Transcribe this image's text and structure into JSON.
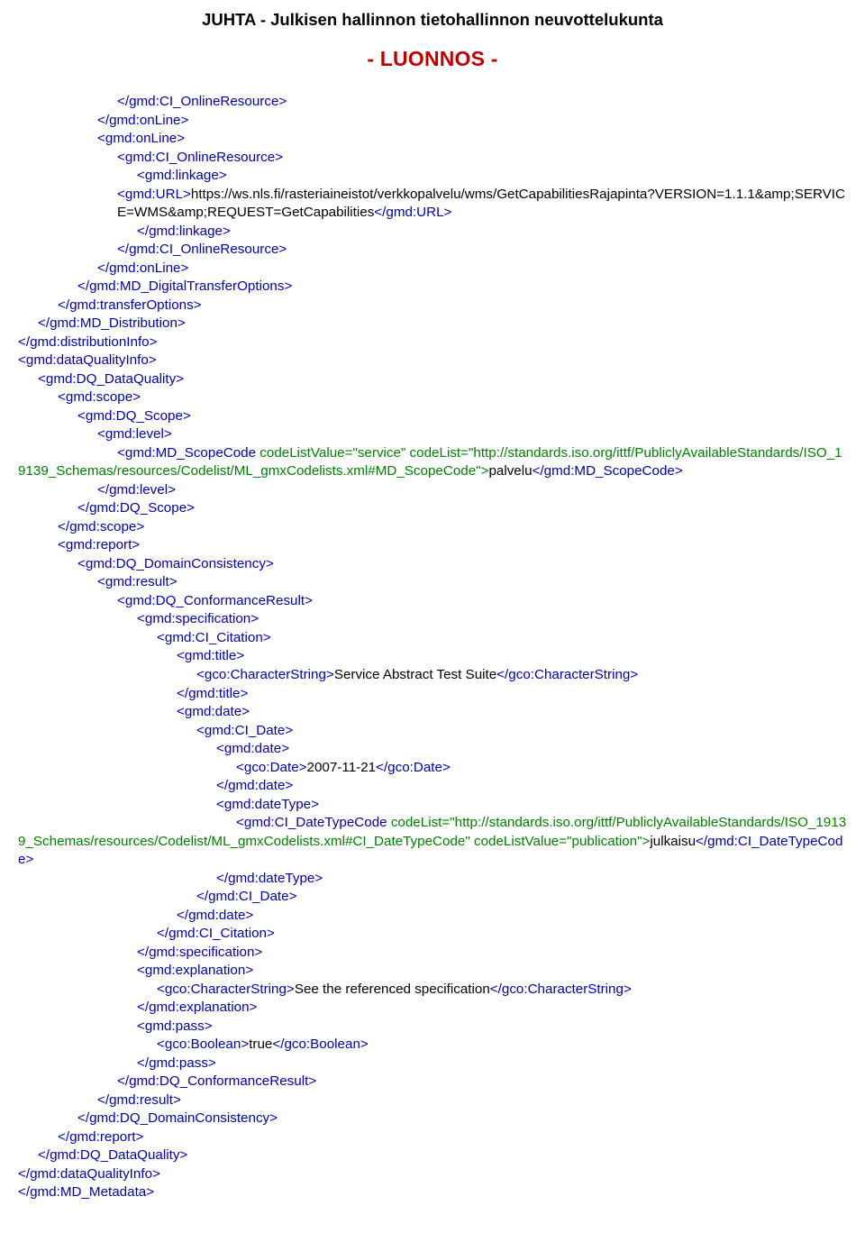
{
  "header": "JUHTA - Julkisen hallinnon tietohallinnon neuvottelukunta",
  "draft": "- LUONNOS -",
  "xml": {
    "l1": "</gmd:CI_OnlineResource>",
    "l2": "</gmd:onLine>",
    "l3": "<gmd:onLine>",
    "l4": "<gmd:CI_OnlineResource>",
    "l5": "<gmd:linkage>",
    "l6a": "<gmd:URL>",
    "l6t": "https://ws.nls.fi/rasteriaineistot/verkkopalvelu/wms/GetCapabilitiesRajapinta?VERSION=1.1.1&amp;SERVICE=WMS&amp;REQUEST=GetCapabilities",
    "l6b": "</gmd:URL>",
    "l7": "</gmd:linkage>",
    "l8": "</gmd:CI_OnlineResource>",
    "l9": "</gmd:onLine>",
    "l10": "</gmd:MD_DigitalTransferOptions>",
    "l11": "</gmd:transferOptions>",
    "l12": "</gmd:MD_Distribution>",
    "l13": "</gmd:distributionInfo>",
    "l14": "<gmd:dataQualityInfo>",
    "l15": "<gmd:DQ_DataQuality>",
    "l16": "<gmd:scope>",
    "l17": "<gmd:DQ_Scope>",
    "l18": "<gmd:level>",
    "l19a": "<gmd:MD_ScopeCode",
    "l19b": " codeListValue=\"service\" codeList=\"http://standards.iso.org/ittf/PubliclyAvailableStandards/ISO_19139_Schemas/resources/Codelist/ML_gmxCodelists.xml#MD_ScopeCode\">",
    "l19t": "palvelu",
    "l19c": "</gmd:MD_ScopeCode>",
    "l20": "</gmd:level>",
    "l21": "</gmd:DQ_Scope>",
    "l22": "</gmd:scope>",
    "l23": "<gmd:report>",
    "l24": "<gmd:DQ_DomainConsistency>",
    "l25": "<gmd:result>",
    "l26": "<gmd:DQ_ConformanceResult>",
    "l27": "<gmd:specification>",
    "l28": "<gmd:CI_Citation>",
    "l29": "<gmd:title>",
    "l30a": "<gco:CharacterString>",
    "l30t": "Service Abstract Test Suite",
    "l30b": "</gco:CharacterString>",
    "l31": "</gmd:title>",
    "l32": "<gmd:date>",
    "l33": "<gmd:CI_Date>",
    "l34": "<gmd:date>",
    "l35a": "<gco:Date>",
    "l35t": "2007-11-21",
    "l35b": "</gco:Date>",
    "l36": "</gmd:date>",
    "l37": "<gmd:dateType>",
    "l38a": "<gmd:CI_DateTypeCode ",
    "l38b": "codeList=\"http://standards.iso.org/ittf/PubliclyAvailableStandards/ISO_19139_Schemas/resources/Codelist/ML_gmxCodelists.xml#CI_DateTypeCode\"",
    "l38c": " codeListValue=\"publication\">",
    "l38t": "julkaisu",
    "l38d": "</gmd:CI_DateTypeCode>",
    "l39": "</gmd:dateType>",
    "l40": "</gmd:CI_Date>",
    "l41": "</gmd:date>",
    "l42": "</gmd:CI_Citation>",
    "l43": "</gmd:specification>",
    "l44": "<gmd:explanation>",
    "l45a": "<gco:CharacterString>",
    "l45t": "See the referenced specification",
    "l45b": "</gco:CharacterString>",
    "l46": "</gmd:explanation>",
    "l47": "<gmd:pass>",
    "l48a": "<gco:Boolean>",
    "l48t": "true",
    "l48b": "</gco:Boolean>",
    "l49": "</gmd:pass>",
    "l50": "</gmd:DQ_ConformanceResult>",
    "l51": "</gmd:result>",
    "l52": "</gmd:DQ_DomainConsistency>",
    "l53": "</gmd:report>",
    "l54": "</gmd:DQ_DataQuality>",
    "l55": "</gmd:dataQualityInfo>",
    "l56": "</gmd:MD_Metadata>"
  }
}
